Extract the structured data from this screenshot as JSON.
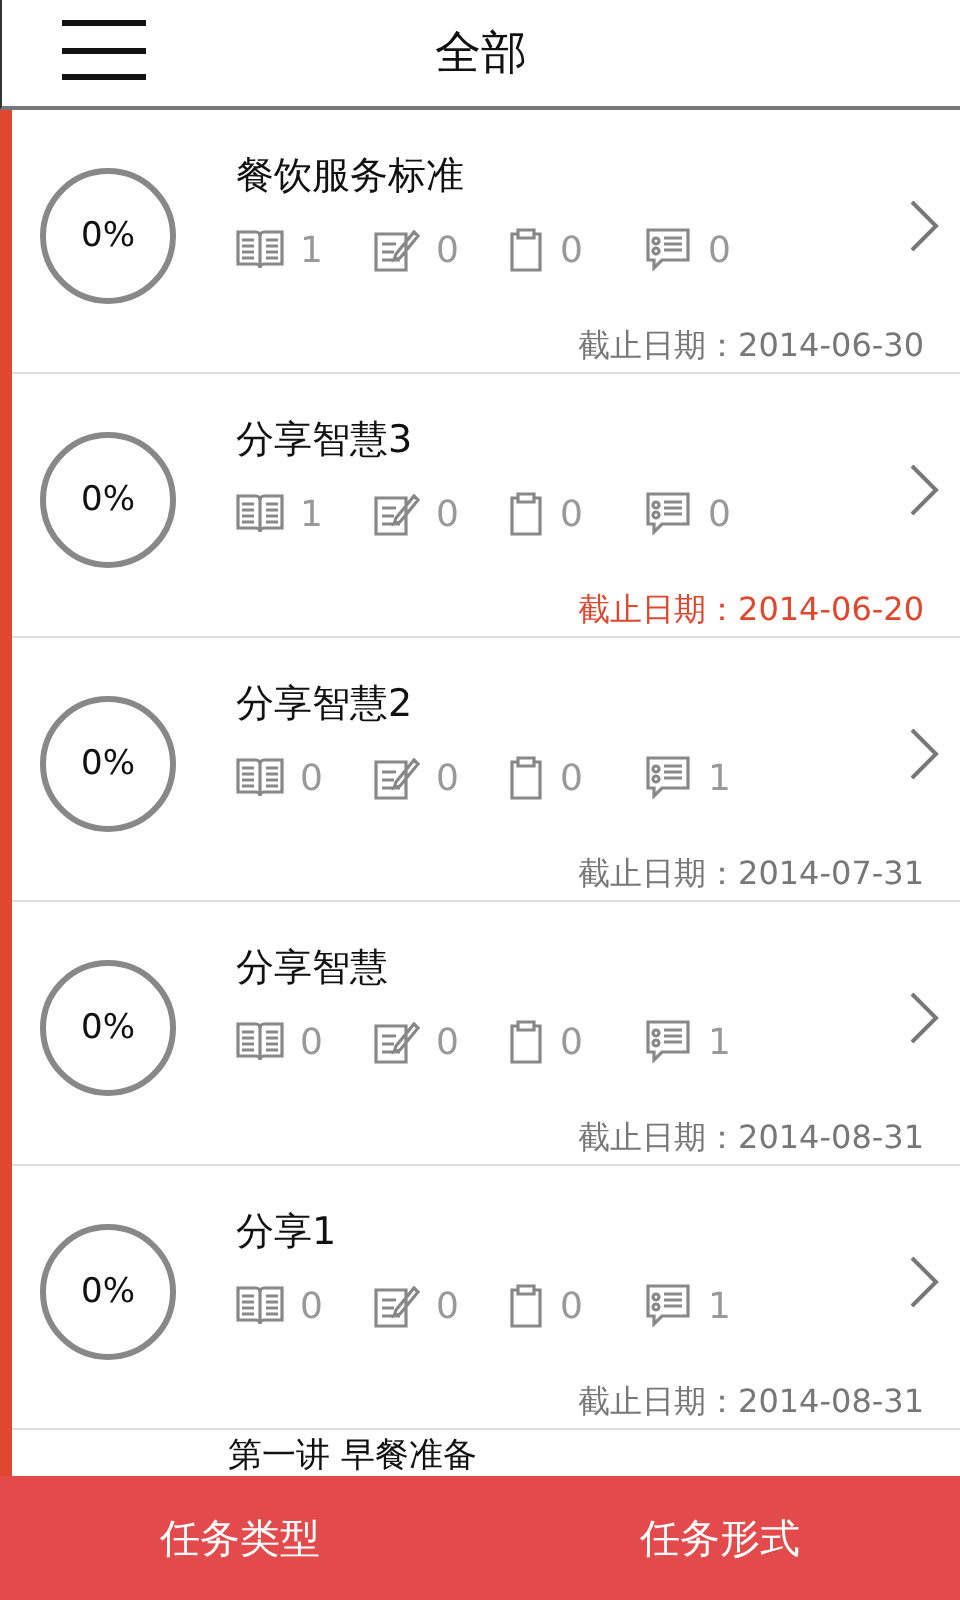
{
  "header": {
    "title": "全部"
  },
  "tasks": [
    {
      "title": "餐饮服务标准",
      "progress": "0%",
      "stats": [
        {
          "kind": "book",
          "count": "1"
        },
        {
          "kind": "notes",
          "count": "0"
        },
        {
          "kind": "clipboard",
          "count": "0"
        },
        {
          "kind": "survey",
          "count": "0"
        }
      ],
      "deadline": "截止日期：2014-06-30",
      "overdue": false
    },
    {
      "title": "分享智慧3",
      "progress": "0%",
      "stats": [
        {
          "kind": "book",
          "count": "1"
        },
        {
          "kind": "notes",
          "count": "0"
        },
        {
          "kind": "clipboard",
          "count": "0"
        },
        {
          "kind": "survey",
          "count": "0"
        }
      ],
      "deadline": "截止日期：2014-06-20",
      "overdue": true
    },
    {
      "title": "分享智慧2",
      "progress": "0%",
      "stats": [
        {
          "kind": "book",
          "count": "0"
        },
        {
          "kind": "notes",
          "count": "0"
        },
        {
          "kind": "clipboard",
          "count": "0"
        },
        {
          "kind": "survey",
          "count": "1"
        }
      ],
      "deadline": "截止日期：2014-07-31",
      "overdue": false
    },
    {
      "title": "分享智慧",
      "progress": "0%",
      "stats": [
        {
          "kind": "book",
          "count": "0"
        },
        {
          "kind": "notes",
          "count": "0"
        },
        {
          "kind": "clipboard",
          "count": "0"
        },
        {
          "kind": "survey",
          "count": "1"
        }
      ],
      "deadline": "截止日期：2014-08-31",
      "overdue": false
    },
    {
      "title": "分享1",
      "progress": "0%",
      "stats": [
        {
          "kind": "book",
          "count": "0"
        },
        {
          "kind": "notes",
          "count": "0"
        },
        {
          "kind": "clipboard",
          "count": "0"
        },
        {
          "kind": "survey",
          "count": "1"
        }
      ],
      "deadline": "截止日期：2014-08-31",
      "overdue": false
    },
    {
      "title": "第一讲 早餐准备"
    }
  ],
  "bottom_bar": {
    "buttons": [
      "任务类型",
      "任务形式"
    ]
  }
}
